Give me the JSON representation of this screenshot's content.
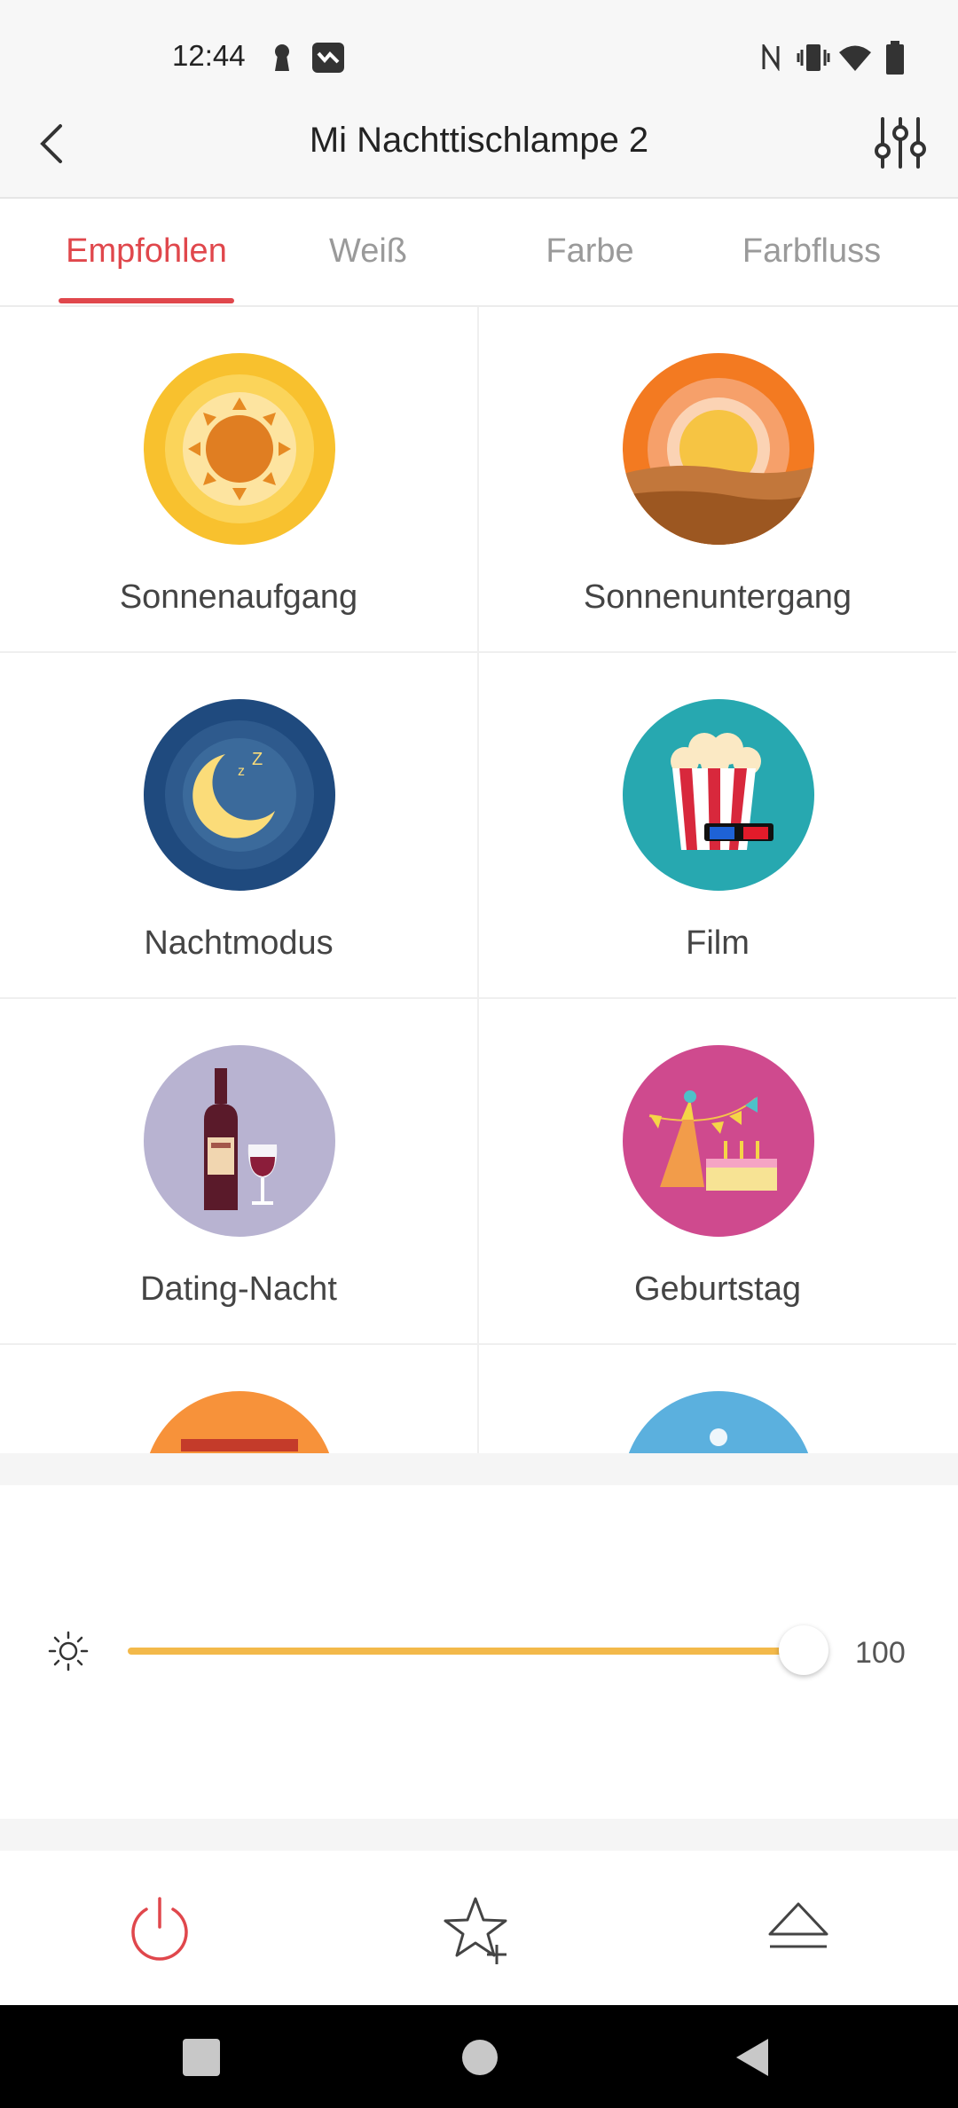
{
  "status_bar": {
    "time": "12:44"
  },
  "header": {
    "title": "Mi Nachttischlampe 2"
  },
  "tabs": [
    {
      "label": "Empfohlen",
      "active": true
    },
    {
      "label": "Weiß",
      "active": false
    },
    {
      "label": "Farbe",
      "active": false
    },
    {
      "label": "Farbfluss",
      "active": false
    }
  ],
  "scenes": [
    {
      "label": "Sonnenaufgang",
      "icon": "sunrise-icon"
    },
    {
      "label": "Sonnenuntergang",
      "icon": "sunset-icon"
    },
    {
      "label": "Nachtmodus",
      "icon": "moon-icon"
    },
    {
      "label": "Film",
      "icon": "popcorn-icon"
    },
    {
      "label": "Dating-Nacht",
      "icon": "wine-icon"
    },
    {
      "label": "Geburtstag",
      "icon": "party-icon"
    }
  ],
  "brightness": {
    "value": "100",
    "level_percent": 100
  },
  "colors": {
    "accent": "#e0474c",
    "slider": "#f3b94a"
  }
}
